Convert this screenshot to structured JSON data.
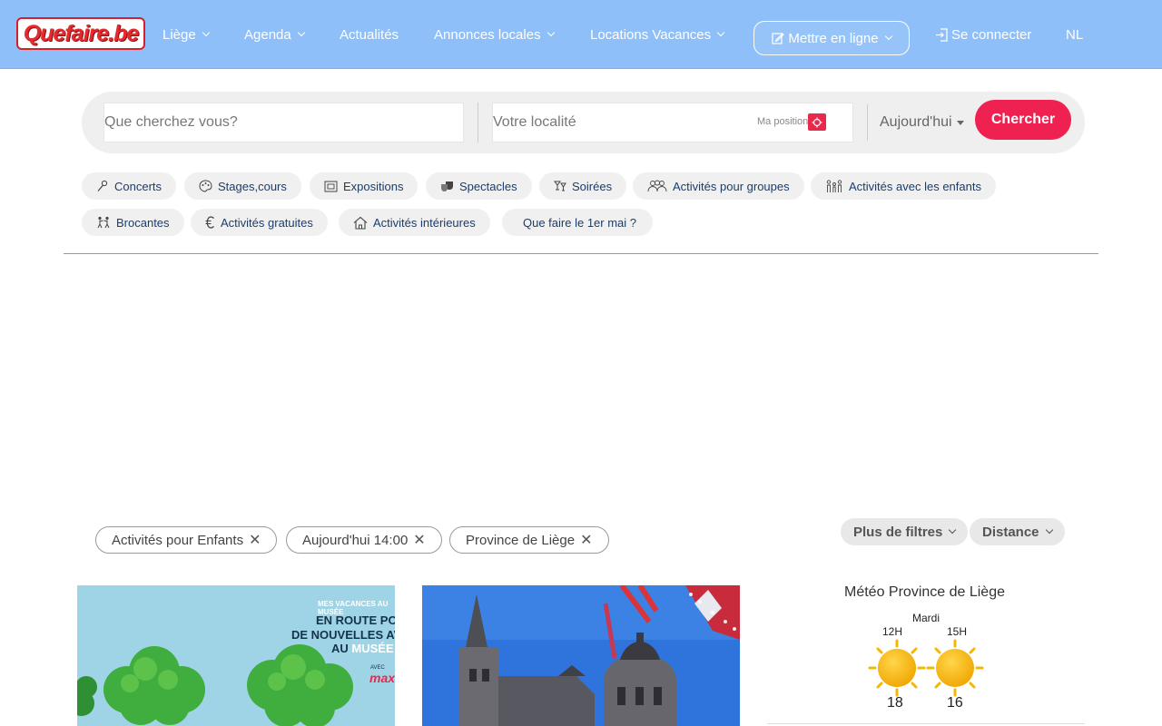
{
  "brand": {
    "logo_text": "Quefaire.be"
  },
  "nav": {
    "items": [
      {
        "label": "Liège",
        "dropdown": true
      },
      {
        "label": "Agenda",
        "dropdown": true
      },
      {
        "label": "Actualités",
        "dropdown": false
      },
      {
        "label": "Annonces locales",
        "dropdown": true
      },
      {
        "label": "Locations Vacances",
        "dropdown": true
      }
    ],
    "publish_label": "Mettre en ligne",
    "login_label": "Se connecter",
    "lang_label": "NL"
  },
  "search": {
    "what_placeholder": "Que cherchez vous?",
    "where_placeholder": "Votre localité",
    "my_position_label": "Ma position",
    "when_label": "Aujourd'hui",
    "submit_label": "Chercher"
  },
  "categories": [
    {
      "label": "Concerts",
      "icon": "microphone-icon"
    },
    {
      "label": "Stages,cours",
      "icon": "palette-icon"
    },
    {
      "label": "Expositions",
      "icon": "frame-icon"
    },
    {
      "label": "Spectacles",
      "icon": "theater-masks-icon"
    },
    {
      "label": "Soirées",
      "icon": "cocktail-icon"
    },
    {
      "label": "Activités pour groupes",
      "icon": "group-icon"
    },
    {
      "label": "Activités avec les enfants",
      "icon": "family-icon"
    },
    {
      "label": "Brocantes",
      "icon": "bargain-icon"
    },
    {
      "label": "Activités gratuites",
      "icon": "euro-icon"
    },
    {
      "label": "Activités intérieures",
      "icon": "house-icon"
    },
    {
      "label": "Que faire le 1er mai ?",
      "icon": ""
    }
  ],
  "active_filters": [
    {
      "label": "Activités pour Enfants"
    },
    {
      "label": "Aujourd'hui 14:00"
    },
    {
      "label": "Province de Liège"
    }
  ],
  "sort": {
    "more_filters_label": "Plus de filtres",
    "distance_label": "Distance"
  },
  "cards": [
    {
      "small_text": "MES VACANCES AU MUSÉE",
      "line1": "EN ROUTE POUR",
      "line2": "DE NOUVELLES AVENT",
      "line3_a": "AU ",
      "line3_b": "MUSÉE",
      "avec": "AVEC",
      "max": "max"
    },
    {}
  ],
  "weather": {
    "title": "Météo Province de Liège",
    "day": "Mardi",
    "slots": [
      {
        "hour": "12H",
        "temp": "18",
        "icon": "sun-icon"
      },
      {
        "hour": "15H",
        "temp": "16",
        "icon": "sun-icon"
      }
    ]
  },
  "colors": {
    "navbar": "#8fbff8",
    "accent": "#ef2150",
    "chip_text": "#1a3d6e"
  }
}
